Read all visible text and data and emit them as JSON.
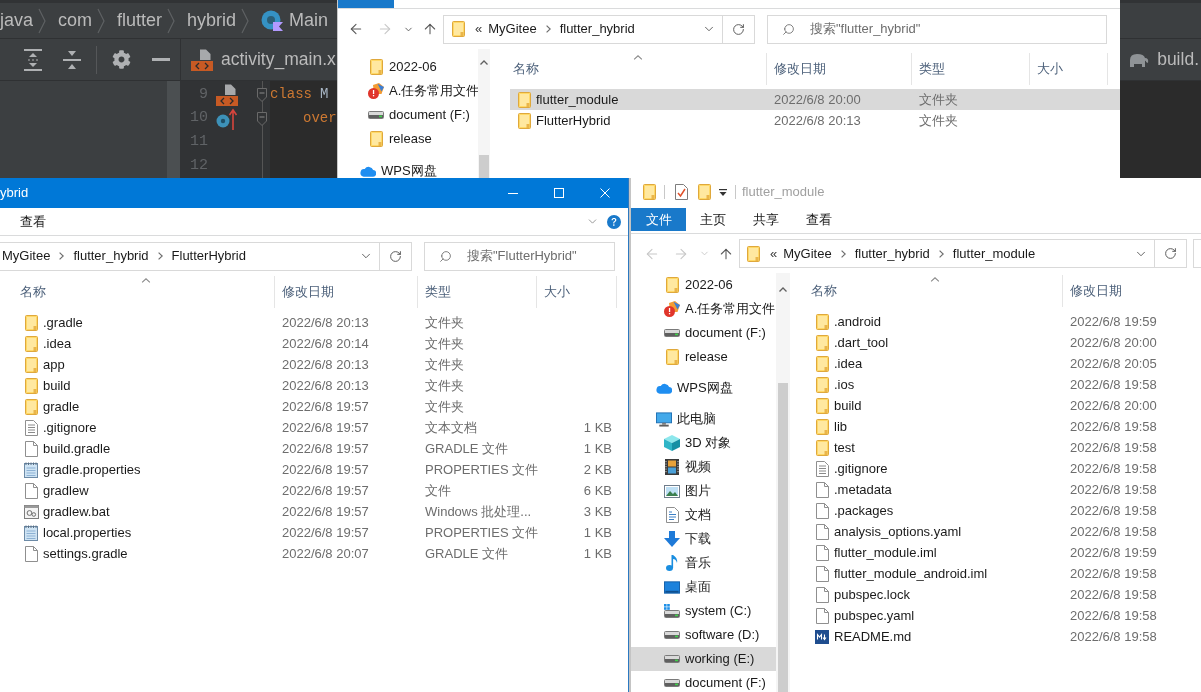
{
  "ide": {
    "breadcrumbs": [
      {
        "label": "java",
        "kind": "package"
      },
      {
        "label": "com",
        "kind": "package"
      },
      {
        "label": "flutter",
        "kind": "package"
      },
      {
        "label": "hybrid",
        "kind": "package"
      },
      {
        "label": "Main",
        "kind": "class"
      }
    ],
    "editor_tabs": [
      {
        "label": "activity_main.x",
        "kind": "xml"
      },
      {
        "label": "build.",
        "kind": "gradle"
      }
    ],
    "lines": [
      {
        "number": "9",
        "gutter": {
          "kind": "xml"
        },
        "fold": true,
        "tokens": [
          {
            "kind": "keyword",
            "text": "class"
          },
          {
            "kind": "name",
            "text": "M"
          }
        ]
      },
      {
        "number": "10",
        "gutter": {
          "kind": "override"
        },
        "fold": true,
        "tokens": [
          {
            "kind": "indent"
          },
          {
            "kind": "keyword",
            "text": "over"
          }
        ]
      },
      {
        "number": "11",
        "fold": false
      },
      {
        "number": "12",
        "fold": false
      }
    ]
  },
  "top_window": {
    "nav": [
      {
        "kind": "back",
        "disabled": false
      },
      {
        "kind": "forward",
        "disabled": true
      },
      {
        "kind": "recent",
        "disabled": false
      },
      {
        "kind": "up",
        "disabled": false
      }
    ],
    "address": {
      "overflow": "«",
      "parts": [
        "MyGitee",
        "flutter_hybrid"
      ]
    },
    "search": {
      "placeholder": "搜索\"flutter_hybrid\""
    },
    "sidebar": {
      "pinned": [
        {
          "label": "2022-06",
          "kind": "folder",
          "selected": false
        },
        {
          "label": "A.任务常用文件",
          "kind": "app",
          "selected": false
        },
        {
          "label": "document (F:)",
          "kind": "drive",
          "selected": false
        },
        {
          "label": "release",
          "kind": "folder",
          "selected": false
        }
      ],
      "tree": [
        {
          "label": "WPS网盘",
          "kind": "cloud",
          "selected": false
        }
      ]
    },
    "columns": [
      {
        "label": "名称",
        "sorted": true
      },
      {
        "label": "修改日期",
        "sorted": false
      },
      {
        "label": "类型",
        "sorted": false
      },
      {
        "label": "大小",
        "sorted": false
      }
    ],
    "rows": [
      {
        "name": "flutter_module",
        "kind": "folder",
        "date": "2022/6/8 20:00",
        "type": "文件夹",
        "selected": true
      },
      {
        "name": "FlutterHybrid",
        "kind": "folder",
        "date": "2022/6/8 20:13",
        "type": "文件夹",
        "selected": false
      }
    ]
  },
  "left_window": {
    "title": "ybrid",
    "active": true,
    "ribbon_tabs": [
      {
        "label": "查看",
        "kind": "tab"
      }
    ],
    "address": {
      "parts": [
        "MyGitee",
        "flutter_hybrid",
        "FlutterHybrid"
      ]
    },
    "search": {
      "placeholder": "搜索\"FlutterHybrid\""
    },
    "columns": [
      {
        "label": "名称",
        "sorted": true
      },
      {
        "label": "修改日期",
        "sorted": false
      },
      {
        "label": "类型",
        "sorted": false
      },
      {
        "label": "大小",
        "sorted": false
      }
    ],
    "rows": [
      {
        "name": ".gradle",
        "kind": "folder",
        "date": "2022/6/8 20:13",
        "type": "文件夹",
        "selected": false
      },
      {
        "name": ".idea",
        "kind": "folder",
        "date": "2022/6/8 20:14",
        "type": "文件夹",
        "selected": false
      },
      {
        "name": "app",
        "kind": "folder",
        "date": "2022/6/8 20:13",
        "type": "文件夹",
        "selected": false
      },
      {
        "name": "build",
        "kind": "folder",
        "date": "2022/6/8 20:13",
        "type": "文件夹",
        "selected": false
      },
      {
        "name": "gradle",
        "kind": "folder",
        "date": "2022/6/8 19:57",
        "type": "文件夹",
        "selected": false
      },
      {
        "name": ".gitignore",
        "kind": "text",
        "date": "2022/6/8 19:57",
        "type": "文本文档",
        "size": "1 KB",
        "selected": false
      },
      {
        "name": "build.gradle",
        "kind": "file",
        "date": "2022/6/8 19:57",
        "type": "GRADLE 文件",
        "size": "1 KB",
        "selected": false
      },
      {
        "name": "gradle.properties",
        "kind": "properties",
        "date": "2022/6/8 19:57",
        "type": "PROPERTIES 文件",
        "size": "2 KB",
        "selected": false
      },
      {
        "name": "gradlew",
        "kind": "file",
        "date": "2022/6/8 19:57",
        "type": "文件",
        "size": "6 KB",
        "selected": false
      },
      {
        "name": "gradlew.bat",
        "kind": "bat",
        "date": "2022/6/8 19:57",
        "type": "Windows 批处理...",
        "size": "3 KB",
        "selected": false
      },
      {
        "name": "local.properties",
        "kind": "properties",
        "date": "2022/6/8 19:57",
        "type": "PROPERTIES 文件",
        "size": "1 KB",
        "selected": false
      },
      {
        "name": "settings.gradle",
        "kind": "file",
        "date": "2022/6/8 20:07",
        "type": "GRADLE 文件",
        "size": "1 KB",
        "selected": false
      }
    ]
  },
  "right_window": {
    "title": "flutter_module",
    "active": false,
    "ribbon_tabs": [
      {
        "label": "文件",
        "kind": "file"
      },
      {
        "label": "主页",
        "kind": "tab"
      },
      {
        "label": "共享",
        "kind": "tab"
      },
      {
        "label": "查看",
        "kind": "tab"
      }
    ],
    "nav": [
      {
        "kind": "back",
        "disabled": true
      },
      {
        "kind": "forward",
        "disabled": true
      },
      {
        "kind": "recent",
        "disabled": true
      },
      {
        "kind": "up",
        "disabled": false
      }
    ],
    "address": {
      "overflow": "«",
      "parts": [
        "MyGitee",
        "flutter_hybrid",
        "flutter_module"
      ]
    },
    "sidebar": {
      "pinned": [
        {
          "label": "2022-06",
          "kind": "folder",
          "selected": false
        },
        {
          "label": "A.任务常用文件",
          "kind": "app",
          "selected": false
        },
        {
          "label": "document (F:)",
          "kind": "drive",
          "selected": false
        },
        {
          "label": "release",
          "kind": "folder",
          "selected": false
        }
      ],
      "tree": [
        {
          "label": "WPS网盘",
          "kind": "cloud",
          "selected": false
        },
        {
          "label": "此电脑",
          "kind": "pc",
          "selected": false,
          "children": [
            {
              "label": "3D 对象",
              "kind": "cube",
              "selected": false
            },
            {
              "label": "视频",
              "kind": "video",
              "selected": false
            },
            {
              "label": "图片",
              "kind": "pictures",
              "selected": false
            },
            {
              "label": "文档",
              "kind": "documents",
              "selected": false
            },
            {
              "label": "下载",
              "kind": "downloads",
              "selected": false
            },
            {
              "label": "音乐",
              "kind": "music",
              "selected": false
            },
            {
              "label": "桌面",
              "kind": "desktop",
              "selected": false
            },
            {
              "label": "system (C:)",
              "kind": "system-drive",
              "selected": false
            },
            {
              "label": "software (D:)",
              "kind": "drive",
              "selected": false
            },
            {
              "label": "working (E:)",
              "kind": "drive",
              "selected": true
            },
            {
              "label": "document (F:)",
              "kind": "drive",
              "selected": false
            }
          ]
        }
      ]
    },
    "columns": [
      {
        "label": "名称",
        "sorted": true
      },
      {
        "label": "修改日期",
        "sorted": false
      }
    ],
    "rows": [
      {
        "name": ".android",
        "kind": "folder",
        "date": "2022/6/8 19:59",
        "selected": false
      },
      {
        "name": ".dart_tool",
        "kind": "folder",
        "date": "2022/6/8 20:00",
        "selected": false
      },
      {
        "name": ".idea",
        "kind": "folder",
        "date": "2022/6/8 20:05",
        "selected": false
      },
      {
        "name": ".ios",
        "kind": "folder",
        "date": "2022/6/8 19:58",
        "selected": false
      },
      {
        "name": "build",
        "kind": "folder",
        "date": "2022/6/8 20:00",
        "selected": false
      },
      {
        "name": "lib",
        "kind": "folder",
        "date": "2022/6/8 19:58",
        "selected": false
      },
      {
        "name": "test",
        "kind": "folder",
        "date": "2022/6/8 19:58",
        "selected": false
      },
      {
        "name": ".gitignore",
        "kind": "text",
        "date": "2022/6/8 19:58",
        "selected": false
      },
      {
        "name": ".metadata",
        "kind": "file",
        "date": "2022/6/8 19:58",
        "selected": false
      },
      {
        "name": ".packages",
        "kind": "file",
        "date": "2022/6/8 19:58",
        "selected": false
      },
      {
        "name": "analysis_options.yaml",
        "kind": "file",
        "date": "2022/6/8 19:58",
        "selected": false
      },
      {
        "name": "flutter_module.iml",
        "kind": "file",
        "date": "2022/6/8 19:59",
        "selected": false
      },
      {
        "name": "flutter_module_android.iml",
        "kind": "file",
        "date": "2022/6/8 19:58",
        "selected": false
      },
      {
        "name": "pubspec.lock",
        "kind": "file",
        "date": "2022/6/8 19:58",
        "selected": false
      },
      {
        "name": "pubspec.yaml",
        "kind": "file",
        "date": "2022/6/8 19:58",
        "selected": false
      },
      {
        "name": "README.md",
        "kind": "markdown",
        "date": "2022/6/8 19:58",
        "selected": false
      }
    ]
  }
}
